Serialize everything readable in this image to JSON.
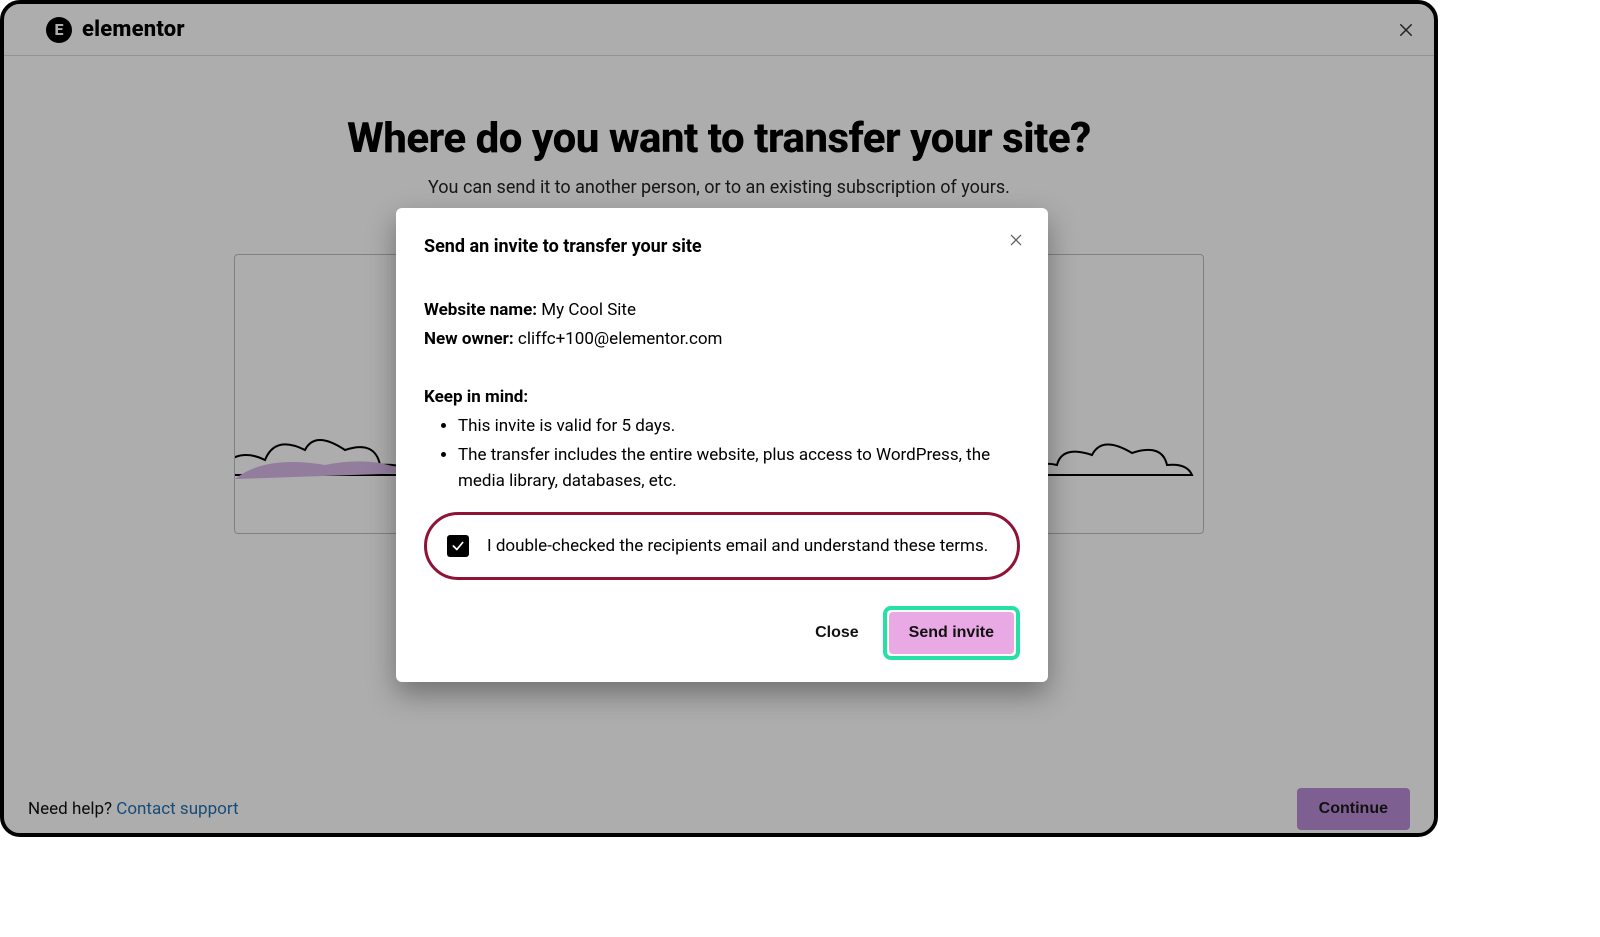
{
  "brand": {
    "name": "elementor",
    "logo_letter": "E"
  },
  "page": {
    "title": "Where do you want to transfer your site?",
    "subtitle": "You can send it to another person, or to an existing subscription of yours."
  },
  "footer": {
    "help_prefix": "Need help? ",
    "help_link": "Contact support",
    "continue": "Continue"
  },
  "modal": {
    "title": "Send an invite to transfer your site",
    "website_label": "Website name:",
    "website_name": "My Cool Site",
    "owner_label": "New owner:",
    "owner_email": "cliffc+100@elementor.com",
    "keep_heading": "Keep in mind:",
    "keep_items": [
      "This invite is valid for 5 days.",
      "The transfer includes the entire website, plus access to WordPress, the media library, databases, etc."
    ],
    "confirm_text": "I double-checked the recipients email and understand these terms.",
    "confirm_checked": true,
    "close_label": "Close",
    "send_label": "Send invite"
  }
}
